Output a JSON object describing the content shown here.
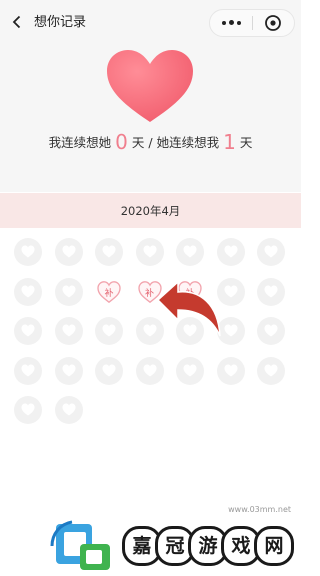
{
  "nav": {
    "title": "想你记录"
  },
  "stats": {
    "part1": "我连续想她",
    "count_mine": "0",
    "part2": "天 / 她连续想我",
    "count_hers": "1",
    "part3": "天"
  },
  "month": {
    "label": "2020年4月"
  },
  "calendar": {
    "makeup_label": "补",
    "days": [
      {
        "state": "empty"
      },
      {
        "state": "empty"
      },
      {
        "state": "empty"
      },
      {
        "state": "empty"
      },
      {
        "state": "empty"
      },
      {
        "state": "empty"
      },
      {
        "state": "empty"
      },
      {
        "state": "empty"
      },
      {
        "state": "empty"
      },
      {
        "state": "makeup"
      },
      {
        "state": "makeup"
      },
      {
        "state": "makeup"
      },
      {
        "state": "empty"
      },
      {
        "state": "empty"
      },
      {
        "state": "empty"
      },
      {
        "state": "empty"
      },
      {
        "state": "empty"
      },
      {
        "state": "empty"
      },
      {
        "state": "empty"
      },
      {
        "state": "empty"
      },
      {
        "state": "empty"
      },
      {
        "state": "empty"
      },
      {
        "state": "empty"
      },
      {
        "state": "empty"
      },
      {
        "state": "empty"
      },
      {
        "state": "empty"
      },
      {
        "state": "empty"
      },
      {
        "state": "empty"
      },
      {
        "state": "empty"
      },
      {
        "state": "empty"
      }
    ]
  },
  "watermark": {
    "url": "www.03mm.net",
    "logo_text": [
      "嘉",
      "冠",
      "游",
      "戏",
      "网"
    ]
  },
  "colors": {
    "heart": "#f6707e",
    "accent_text": "#f07f8e",
    "band": "#f9e7e6",
    "empty_cell": "#f1f1f1",
    "arrow": "#c53a2e"
  }
}
